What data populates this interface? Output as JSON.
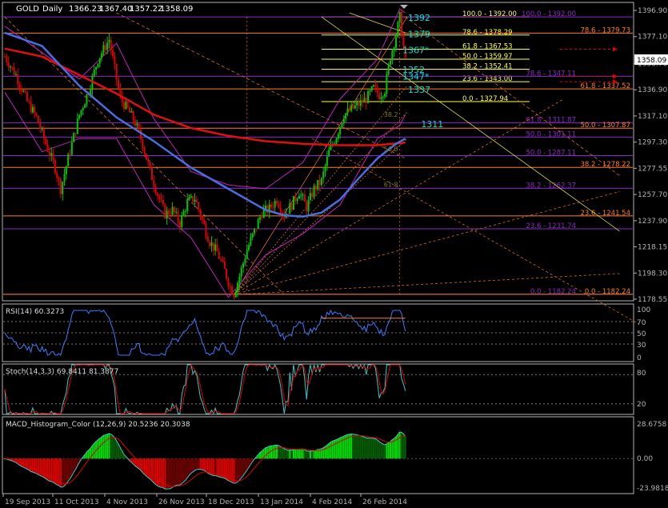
{
  "header": {
    "symbol": "GOLD",
    "timeframe": "Daily",
    "open": "1366.23",
    "high": "1367.40",
    "low": "1357.22",
    "close": "1358.09"
  },
  "current_price": "1358.09",
  "indicators": {
    "rsi": {
      "label": "RSI(14) 60.3273",
      "levels": [
        "100",
        "70",
        "50",
        "30",
        "0"
      ]
    },
    "stoch": {
      "label": "Stoch(14,3,3) 69.8411 81.3877",
      "levels": [
        "80",
        "20"
      ]
    },
    "macd": {
      "label": "MACD_Histogram_Color (12,26,9) 20.5236 20.3038",
      "levels": [
        "28.6758",
        "0.00",
        "-23.9818"
      ]
    }
  },
  "colors": {
    "background": "#000000",
    "axis": "#b4b4b4",
    "bull": "#00c800",
    "bear": "#e00000",
    "ma_red": "#e01010",
    "ma_blue": "#4a6ee0",
    "band": "#c020c0",
    "fib_orange": "#ff7f27",
    "fib_purple": "#8c28c8",
    "fib_yellow": "#ffff40",
    "cyan": "#00e0e0"
  },
  "chart_data": {
    "type": "candlestick",
    "title": "GOLD,Daily",
    "y_ticks": [
      "1396.90",
      "1377.10",
      "1356.70",
      "1336.90",
      "1317.10",
      "1297.30",
      "1277.55",
      "1257.70",
      "1237.90",
      "1218.15",
      "1198.30",
      "1178.55"
    ],
    "x_ticks": [
      "19 Sep 2013",
      "11 Oct 2013",
      "4 Nov 2013",
      "26 Nov 2013",
      "18 Dec 2013",
      "13 Jan 2014",
      "4 Feb 2014",
      "26 Feb 2014"
    ],
    "ylim": [
      1178.55,
      1396.9
    ],
    "price_path": [
      {
        "x": 0,
        "y": 1362
      },
      {
        "x": 6,
        "y": 1348
      },
      {
        "x": 12,
        "y": 1328
      },
      {
        "x": 17,
        "y": 1316
      },
      {
        "x": 22,
        "y": 1296
      },
      {
        "x": 27,
        "y": 1278
      },
      {
        "x": 30,
        "y": 1262
      },
      {
        "x": 34,
        "y": 1285
      },
      {
        "x": 40,
        "y": 1318
      },
      {
        "x": 45,
        "y": 1336
      },
      {
        "x": 50,
        "y": 1360
      },
      {
        "x": 56,
        "y": 1375
      },
      {
        "x": 62,
        "y": 1330
      },
      {
        "x": 66,
        "y": 1322
      },
      {
        "x": 70,
        "y": 1312
      },
      {
        "x": 74,
        "y": 1296
      },
      {
        "x": 78,
        "y": 1275
      },
      {
        "x": 82,
        "y": 1258
      },
      {
        "x": 86,
        "y": 1243
      },
      {
        "x": 90,
        "y": 1246
      },
      {
        "x": 94,
        "y": 1236
      },
      {
        "x": 98,
        "y": 1252
      },
      {
        "x": 102,
        "y": 1255
      },
      {
        "x": 106,
        "y": 1238
      },
      {
        "x": 110,
        "y": 1222
      },
      {
        "x": 114,
        "y": 1214
      },
      {
        "x": 118,
        "y": 1200
      },
      {
        "x": 121,
        "y": 1188
      },
      {
        "x": 123,
        "y": 1183
      },
      {
        "x": 126,
        "y": 1196
      },
      {
        "x": 130,
        "y": 1216
      },
      {
        "x": 134,
        "y": 1230
      },
      {
        "x": 138,
        "y": 1244
      },
      {
        "x": 142,
        "y": 1247
      },
      {
        "x": 146,
        "y": 1254
      },
      {
        "x": 150,
        "y": 1242
      },
      {
        "x": 154,
        "y": 1250
      },
      {
        "x": 158,
        "y": 1260
      },
      {
        "x": 162,
        "y": 1248
      },
      {
        "x": 166,
        "y": 1262
      },
      {
        "x": 170,
        "y": 1268
      },
      {
        "x": 174,
        "y": 1290
      },
      {
        "x": 178,
        "y": 1302
      },
      {
        "x": 182,
        "y": 1318
      },
      {
        "x": 186,
        "y": 1322
      },
      {
        "x": 190,
        "y": 1326
      },
      {
        "x": 194,
        "y": 1330
      },
      {
        "x": 198,
        "y": 1338
      },
      {
        "x": 201,
        "y": 1333
      },
      {
        "x": 204,
        "y": 1337
      },
      {
        "x": 207,
        "y": 1362
      },
      {
        "x": 210,
        "y": 1378
      },
      {
        "x": 212,
        "y": 1392
      },
      {
        "x": 215,
        "y": 1358
      }
    ],
    "candle_count": 216,
    "moving_averages": [
      {
        "name": "ma_red",
        "points": [
          [
            0,
            1368
          ],
          [
            20,
            1362
          ],
          [
            40,
            1348
          ],
          [
            60,
            1334
          ],
          [
            80,
            1318
          ],
          [
            100,
            1308
          ],
          [
            120,
            1302
          ],
          [
            140,
            1298
          ],
          [
            160,
            1296
          ],
          [
            180,
            1295
          ],
          [
            200,
            1295
          ],
          [
            215,
            1297
          ]
        ]
      },
      {
        "name": "ma_blue",
        "points": [
          [
            0,
            1380
          ],
          [
            20,
            1370
          ],
          [
            40,
            1340
          ],
          [
            60,
            1316
          ],
          [
            80,
            1298
          ],
          [
            100,
            1278
          ],
          [
            120,
            1262
          ],
          [
            140,
            1246
          ],
          [
            150,
            1242
          ],
          [
            160,
            1241
          ],
          [
            170,
            1244
          ],
          [
            180,
            1254
          ],
          [
            190,
            1270
          ],
          [
            200,
            1285
          ],
          [
            210,
            1296
          ],
          [
            215,
            1300
          ]
        ]
      }
    ],
    "bands": [
      {
        "name": "upper",
        "points": [
          [
            0,
            1385
          ],
          [
            20,
            1365
          ],
          [
            40,
            1345
          ],
          [
            60,
            1372
          ],
          [
            80,
            1315
          ],
          [
            100,
            1275
          ],
          [
            120,
            1265
          ],
          [
            140,
            1262
          ],
          [
            160,
            1282
          ],
          [
            180,
            1330
          ],
          [
            200,
            1360
          ],
          [
            212,
            1398
          ],
          [
            215,
            1395
          ]
        ]
      },
      {
        "name": "lower",
        "points": [
          [
            0,
            1335
          ],
          [
            20,
            1290
          ],
          [
            40,
            1300
          ],
          [
            60,
            1300
          ],
          [
            80,
            1250
          ],
          [
            100,
            1225
          ],
          [
            120,
            1180
          ],
          [
            140,
            1212
          ],
          [
            160,
            1228
          ],
          [
            180,
            1250
          ],
          [
            200,
            1300
          ],
          [
            212,
            1310
          ],
          [
            215,
            1318
          ]
        ]
      }
    ],
    "fib_levels": [
      {
        "price": 1392.0,
        "label": "100.0 - 1392.00",
        "color": "#ffff40",
        "x0": 170
      },
      {
        "price": 1378.29,
        "label": "78.6 - 1378.29",
        "color": "#ffff40",
        "x0": 170
      },
      {
        "price": 1367.53,
        "label": "61.8 - 1367.53",
        "color": "#ffff40",
        "x0": 170
      },
      {
        "price": 1359.97,
        "label": "50.0 - 1359.97",
        "color": "#ffff40",
        "x0": 170
      },
      {
        "price": 1352.41,
        "label": "38.2 - 1352.41",
        "color": "#ffff40",
        "x0": 170
      },
      {
        "price": 1343.0,
        "label": "23.6 - 1343.00",
        "color": "#ffff40",
        "x0": 170
      },
      {
        "price": 1327.94,
        "label": "0.0 - 1327.94",
        "color": "#ffff40",
        "x0": 170
      },
      {
        "price": 1392.0,
        "label": "100.0 - 1392.00",
        "color": "#8c28c8",
        "x0": 0
      },
      {
        "price": 1379.73,
        "label": "78.6 - 1379.73",
        "color": "#ff7f27",
        "x0": 0
      },
      {
        "price": 1347.11,
        "label": "78.6 - 1347.11",
        "color": "#8c28c8",
        "x0": 0
      },
      {
        "price": 1337.52,
        "label": "61.8 - 1337.52",
        "color": "#ff7f27",
        "x0": 0
      },
      {
        "price": 1311.87,
        "label": "61.8 - 1311.87",
        "color": "#8c28c8",
        "x0": 0
      },
      {
        "price": 1307.87,
        "label": "50.0 - 1307.87",
        "color": "#ff7f27",
        "x0": 0
      },
      {
        "price": 1301.11,
        "label": "50.0 - 1301.11",
        "color": "#8c28c8",
        "x0": 0
      },
      {
        "price": 1287.11,
        "label": "50.0 - 1287.11",
        "color": "#8c28c8",
        "x0": 0
      },
      {
        "price": 1278.22,
        "label": "38.2 - 1278.22",
        "color": "#ff7f27",
        "x0": 0
      },
      {
        "price": 1262.37,
        "label": "38.2 - 1262.37",
        "color": "#8c28c8",
        "x0": 0
      },
      {
        "price": 1241.54,
        "label": "23.6 - 1241.54",
        "color": "#ff7f27",
        "x0": 0
      },
      {
        "price": 1231.74,
        "label": "23.6 - 1231.74",
        "color": "#8c28c8",
        "x0": 0
      },
      {
        "price": 1182.24,
        "label": "0.0 - 1182.24",
        "color": "#8c28c8",
        "x0": 0
      },
      {
        "price": 1182.24,
        "label": "0.0 - 1182.24",
        "color": "#ff7f27",
        "x0": 0
      }
    ],
    "annotations": [
      {
        "text": "1392",
        "price": 1391.5,
        "bar": 213,
        "color": "#00e0e0"
      },
      {
        "text": "1379",
        "price": 1379.0,
        "bar": 213,
        "color": "#00e0e0"
      },
      {
        "text": "1367*",
        "price": 1367.0,
        "bar": 210,
        "color": "#00e0e0"
      },
      {
        "text": "1352",
        "price": 1352.0,
        "bar": 210,
        "color": "#00e0e0"
      },
      {
        "text": "1347*",
        "price": 1347.0,
        "bar": 210,
        "color": "#00e0e0"
      },
      {
        "text": "1337",
        "price": 1337.0,
        "bar": 213,
        "color": "#00e0e0"
      },
      {
        "text": "1311",
        "price": 1311.0,
        "bar": 220,
        "color": "#00e0e0"
      },
      {
        "text": "38.2",
        "price": 1319.0,
        "bar": 200,
        "color": "#808000"
      },
      {
        "text": "50.0",
        "price": 1293.0,
        "bar": 200,
        "color": "#808000"
      },
      {
        "text": "61.8",
        "price": 1266.0,
        "bar": 200,
        "color": "#808000"
      }
    ]
  }
}
